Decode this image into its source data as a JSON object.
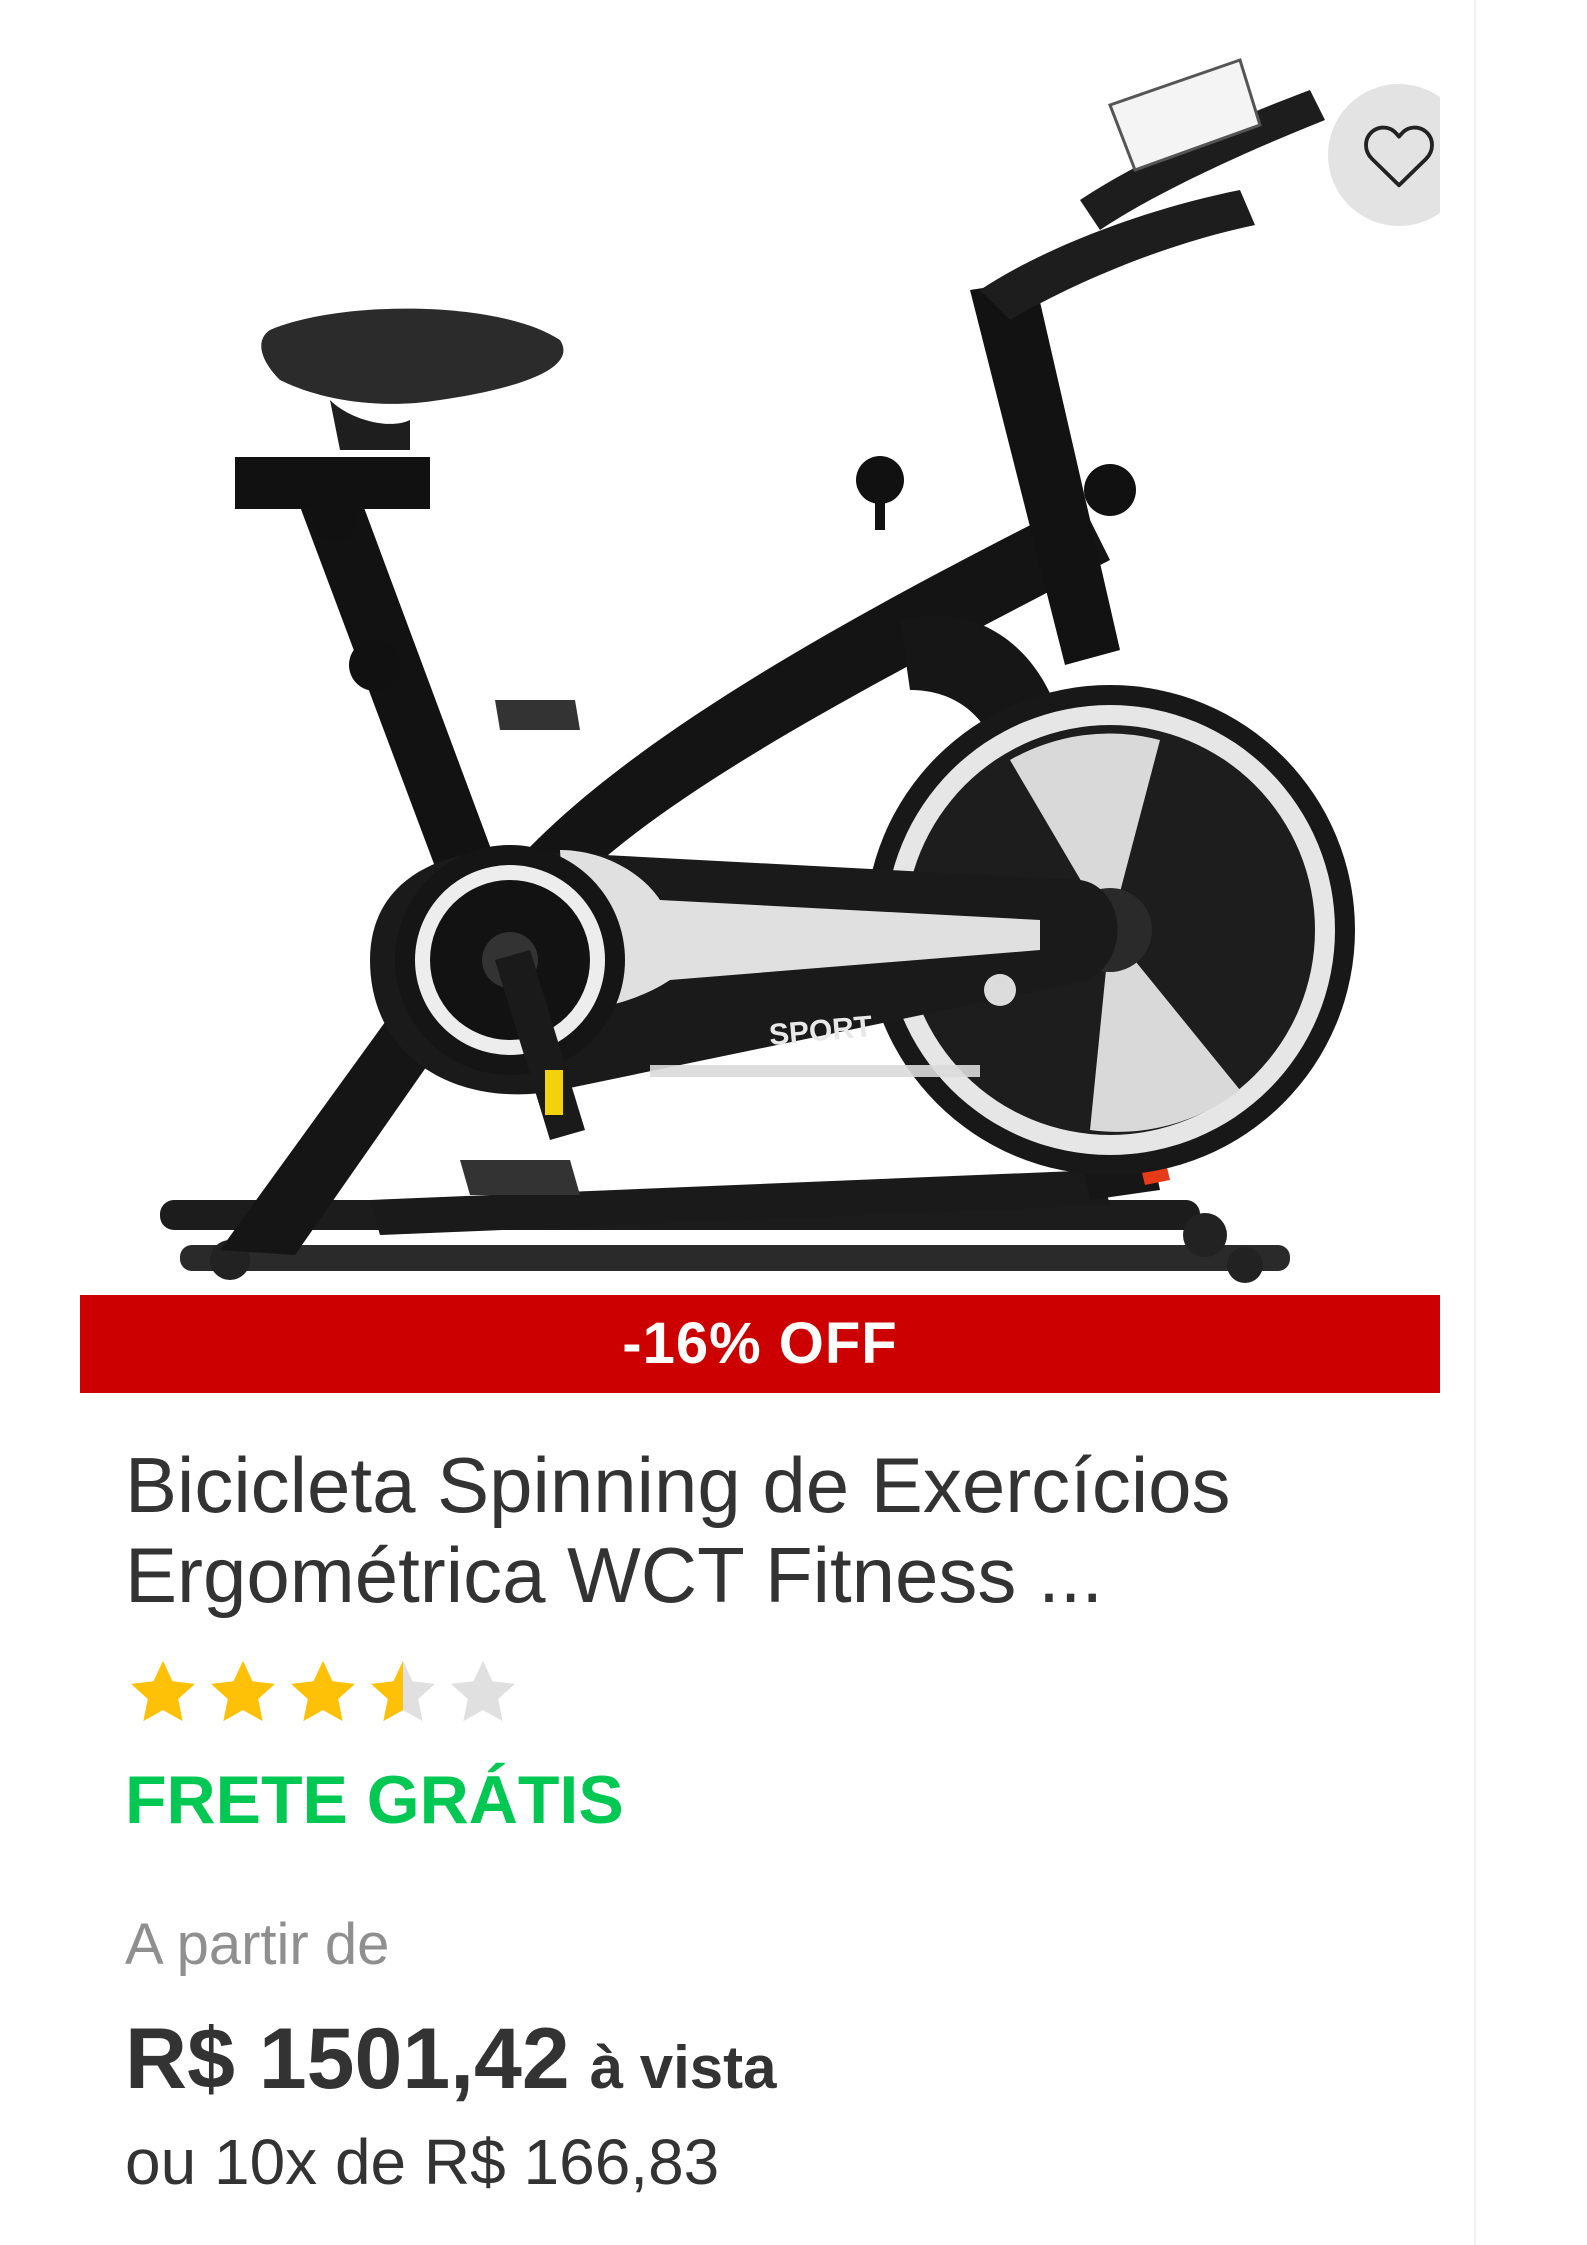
{
  "product": {
    "title_line1": "Bicicleta Spinning de Exercícios",
    "title_line2": "Ergométrica WCT Fitness ...",
    "discount_label": "-16% OFF",
    "shipping_label": "FRETE GRÁTIS",
    "price_prefix": "A partir de",
    "price": "R$ 1501,42",
    "price_suffix": "à vista",
    "installments": "ou 10x de R$ 166,83",
    "rating": {
      "value": 3.5,
      "max": 5
    },
    "image": {
      "icon": "exercise-bike-image",
      "frame_text": "SPORT"
    }
  },
  "favorite": {
    "icon": "heart-icon"
  },
  "colors": {
    "discount_banner": "#cc0000",
    "shipping": "#00c853",
    "star_filled": "#ffc107",
    "star_empty": "#e0e0e0",
    "favorite_bg": "#e3e3e3"
  }
}
